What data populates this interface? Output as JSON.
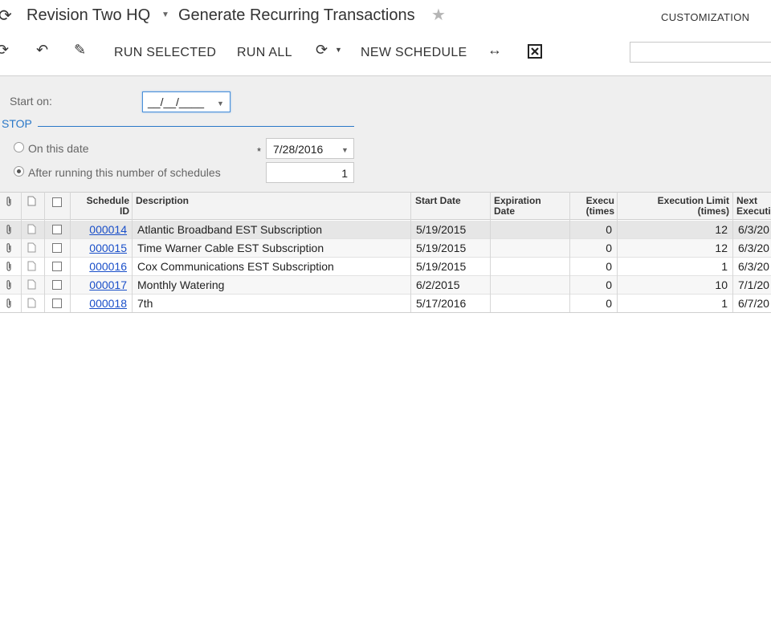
{
  "header": {
    "company": "Revision Two HQ",
    "title": "Generate Recurring Transactions",
    "customization": "CUSTOMIZATION"
  },
  "toolbar": {
    "run_selected": "RUN SELECTED",
    "run_all": "RUN ALL",
    "new_schedule": "NEW SCHEDULE",
    "search_value": ""
  },
  "form": {
    "start_on_label": "Start on:",
    "start_on_value": "__/__/____",
    "stop_title": "STOP",
    "on_this_date_label": "On this date",
    "on_this_date_value": "7/28/2016",
    "required_mark": "*",
    "after_running_label": "After running this number of schedules",
    "after_running_value": "1"
  },
  "grid": {
    "headers": {
      "schedule_id": [
        "Schedule",
        "ID"
      ],
      "description": "Description",
      "start_date": "Start Date",
      "expiration_date": [
        "Expiration",
        "Date"
      ],
      "execution_count": [
        "Execu",
        "(times"
      ],
      "execution_limit": [
        "Execution Limit",
        "(times)"
      ],
      "next_execution": [
        "Next",
        "Executi"
      ]
    },
    "rows": [
      {
        "id": "000014",
        "description": "Atlantic Broadband EST Subscription",
        "start_date": "5/19/2015",
        "expiration_date": "",
        "executed": "0",
        "limit": "12",
        "next": "6/3/20"
      },
      {
        "id": "000015",
        "description": "Time Warner Cable EST Subscription",
        "start_date": "5/19/2015",
        "expiration_date": "",
        "executed": "0",
        "limit": "12",
        "next": "6/3/20"
      },
      {
        "id": "000016",
        "description": "Cox Communications EST Subscription",
        "start_date": "5/19/2015",
        "expiration_date": "",
        "executed": "0",
        "limit": "1",
        "next": "6/3/20"
      },
      {
        "id": "000017",
        "description": "Monthly Watering",
        "start_date": "6/2/2015",
        "expiration_date": "",
        "executed": "0",
        "limit": "10",
        "next": "7/1/20"
      },
      {
        "id": "000018",
        "description": "7th",
        "start_date": "5/17/2016",
        "expiration_date": "",
        "executed": "0",
        "limit": "1",
        "next": "6/7/20"
      }
    ]
  },
  "colors": {
    "link": "#1a4fc9",
    "accent": "#2a78c8",
    "form_bg": "#efefef"
  }
}
